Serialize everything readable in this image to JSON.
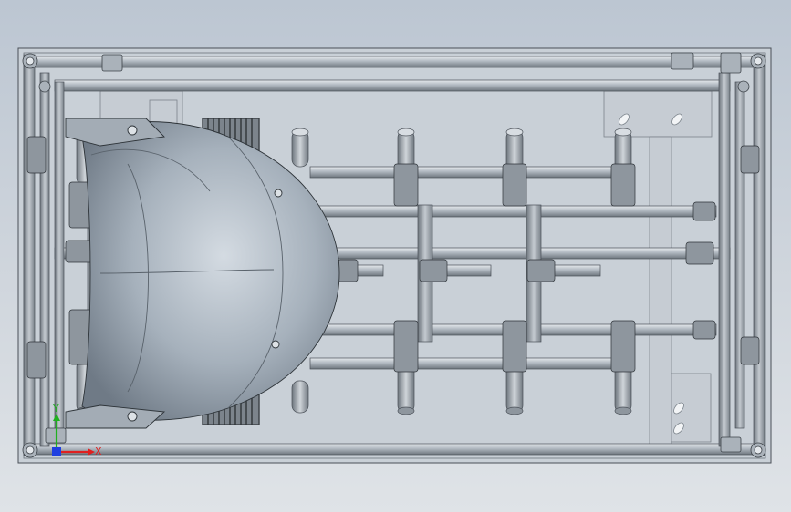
{
  "viewport": {
    "background_top": "#bcc6d2",
    "background_bottom": "#dfe3e7"
  },
  "model": {
    "frame_color": "#b4bcc4",
    "tube_color": "#a9b1b9",
    "plate_color": "#c6ccd3",
    "shell_color": "#9aa5b1",
    "spring_color": "#6f777f",
    "clamp_color": "#8e969e"
  },
  "triad": {
    "x_label": "X",
    "y_label": "Y",
    "x_color": "#e02020",
    "y_color": "#20b020",
    "z_color": "#2040e0"
  }
}
